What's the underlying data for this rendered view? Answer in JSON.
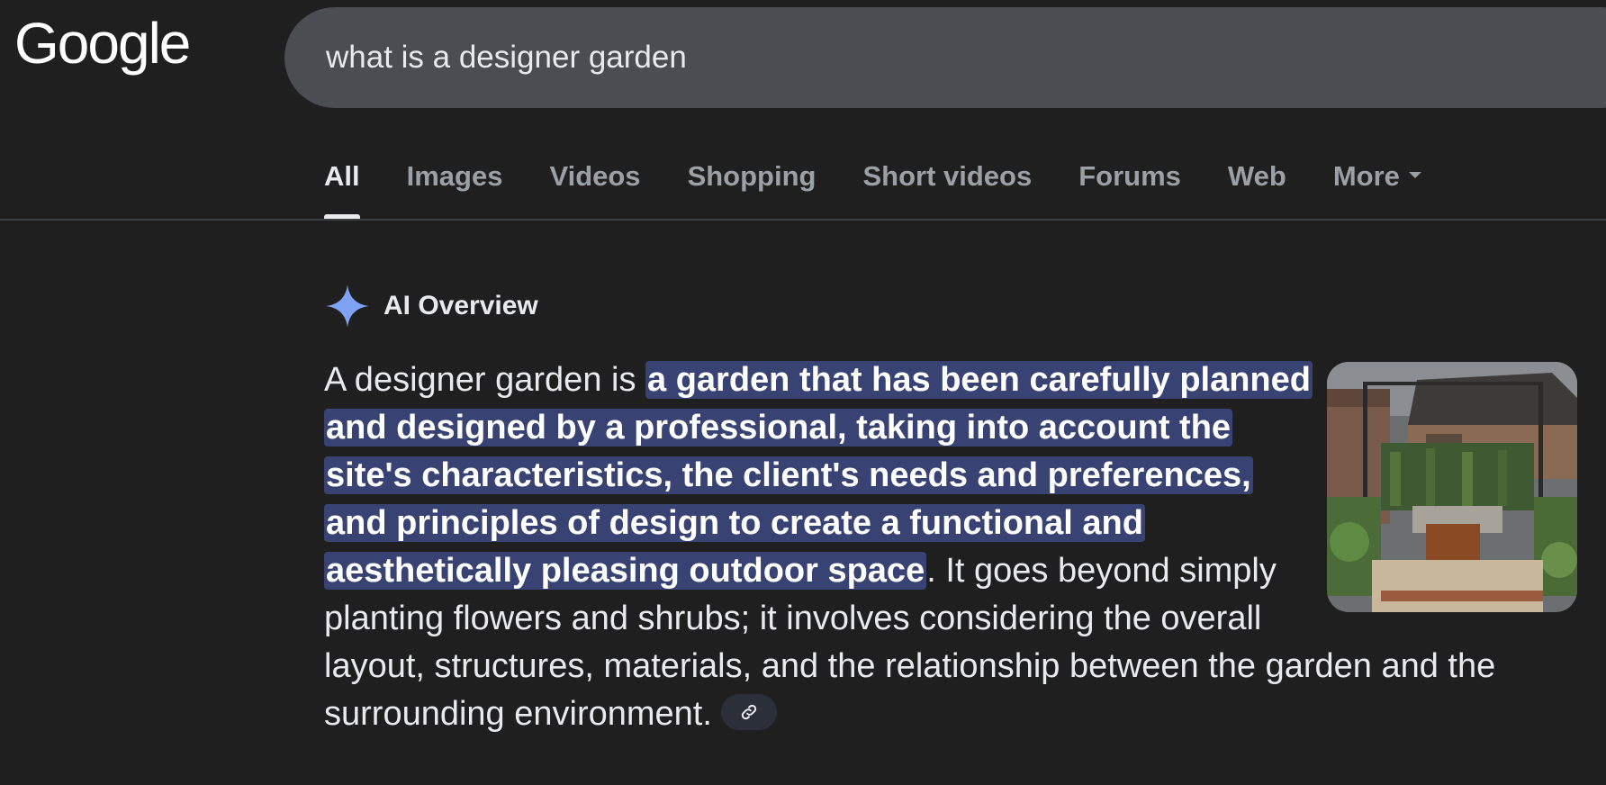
{
  "header": {
    "logo_text": "Google",
    "search_query": "what is a designer garden"
  },
  "tabs": [
    {
      "label": "All",
      "active": true
    },
    {
      "label": "Images",
      "active": false
    },
    {
      "label": "Videos",
      "active": false
    },
    {
      "label": "Shopping",
      "active": false
    },
    {
      "label": "Short videos",
      "active": false
    },
    {
      "label": "Forums",
      "active": false
    },
    {
      "label": "Web",
      "active": false
    },
    {
      "label": "More",
      "active": false,
      "icon": "caret-down-icon"
    }
  ],
  "ai_overview": {
    "icon": "sparkle-icon",
    "title": "AI Overview",
    "text_intro": "A designer garden is ",
    "text_highlight": "a garden that has been carefully planned and designed by a professional, taking into account the site's characteristics, the client's needs and preferences, and principles of design to create a functional and aesthetically pleasing outdoor space",
    "text_rest": ". It goes beyond simply planting flowers and shrubs; it involves considering the overall layout, structures, materials, and the relationship between the garden and the surrounding environment.",
    "link_icon": "link-icon",
    "image_alt": "garden thumbnail"
  },
  "colors": {
    "background": "#1f1f1f",
    "search_bg": "#4a4d51",
    "highlight": "#394373",
    "sparkle": "#7ea3f5",
    "tab_inactive": "#9aa0a6"
  }
}
